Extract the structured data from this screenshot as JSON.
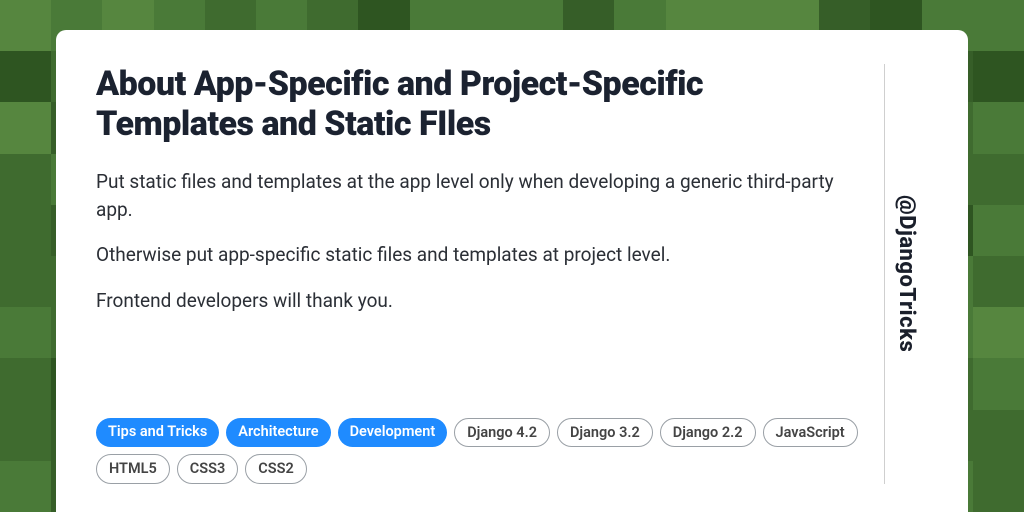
{
  "handle": "@DjangoTricks",
  "title": "About App-Specific and Project-Specific Templates and Static FIles",
  "paragraphs": [
    "Put static files and templates at the app level only when developing a generic third-party app.",
    "Otherwise put app-specific static files and templates at project level.",
    "Frontend developers will thank you."
  ],
  "tags": [
    {
      "label": "Tips and Tricks",
      "variant": "primary"
    },
    {
      "label": "Architecture",
      "variant": "primary"
    },
    {
      "label": "Development",
      "variant": "primary"
    },
    {
      "label": "Django 4.2",
      "variant": "secondary"
    },
    {
      "label": "Django 3.2",
      "variant": "secondary"
    },
    {
      "label": "Django 2.2",
      "variant": "secondary"
    },
    {
      "label": "JavaScript",
      "variant": "secondary"
    },
    {
      "label": "HTML5",
      "variant": "secondary"
    },
    {
      "label": "CSS3",
      "variant": "secondary"
    },
    {
      "label": "CSS2",
      "variant": "secondary"
    }
  ],
  "colors": {
    "primary_tag_bg": "#1f8bff",
    "card_bg": "#ffffff"
  }
}
